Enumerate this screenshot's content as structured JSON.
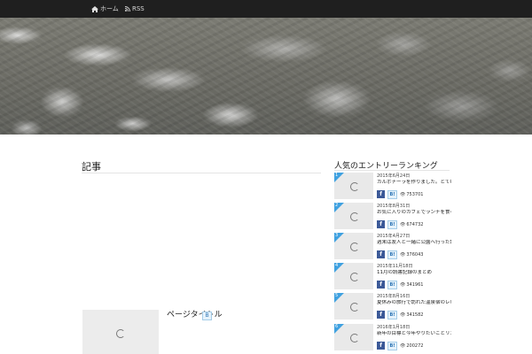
{
  "nav": {
    "home_label": "ホーム",
    "rss_label": "RSS"
  },
  "page": {
    "title": "記事"
  },
  "post": {
    "title": "ページタイトル",
    "badge": "B"
  },
  "sidebar": {
    "title": "人気のエントリーランキング",
    "items": [
      {
        "rank": "1",
        "date": "2015年6月24日",
        "title": "カルボナーラを作りました。とても美味しかったです",
        "views": "753701"
      },
      {
        "rank": "2",
        "date": "2015年8月31日",
        "title": "お気に入りのカフェでランチを食べてきました。",
        "views": "674732"
      },
      {
        "rank": "3",
        "date": "2015年4月27日",
        "title": "週末は友人と一緒に公園へ行った話",
        "views": "376043"
      },
      {
        "rank": "4",
        "date": "2015年11月18日",
        "title": "11月の読書記録のまとめ",
        "views": "341961"
      },
      {
        "rank": "5",
        "date": "2015年8月16日",
        "title": "夏休みの旅行で訪れた温泉宿のレビューと感想です",
        "views": "341582"
      },
      {
        "rank": "6",
        "date": "2016年1月18日",
        "title": "新年の目標と今年やりたいことリスト（前編）",
        "views": "200272"
      }
    ]
  },
  "colors": {
    "topbar": "#1f1f1f",
    "rank_badge": "#3fa1e0",
    "facebook": "#3b5998"
  },
  "icons": {
    "home": "home-icon",
    "rss": "rss-icon",
    "spinner": "loading-spinner-icon",
    "views": "eye-icon"
  }
}
